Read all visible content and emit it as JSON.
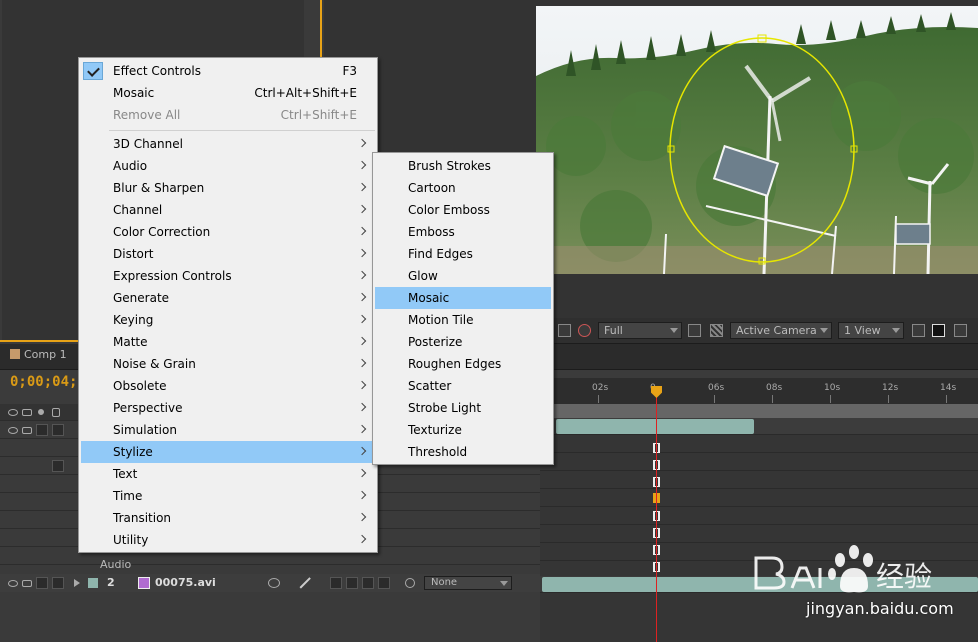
{
  "timeline": {
    "tab_label": "Comp 1",
    "timecode": "0;00;04;0",
    "ticks": [
      "02s",
      "0",
      "06s",
      "08s",
      "10s",
      "12s",
      "14s"
    ],
    "audio_label": "Audio",
    "layer2": {
      "number": "2",
      "name": "00075.avi",
      "parent": "None"
    }
  },
  "viewer": {
    "resolution": "Full",
    "camera": "Active Camera",
    "view": "1 View"
  },
  "context_menu": {
    "items": [
      {
        "label": "Effect Controls",
        "shortcut": "F3",
        "checked": true
      },
      {
        "label": "Mosaic",
        "shortcut": "Ctrl+Alt+Shift+E"
      },
      {
        "label": "Remove All",
        "shortcut": "Ctrl+Shift+E",
        "disabled": true
      }
    ],
    "categories": [
      "3D Channel",
      "Audio",
      "Blur & Sharpen",
      "Channel",
      "Color Correction",
      "Distort",
      "Expression Controls",
      "Generate",
      "Keying",
      "Matte",
      "Noise & Grain",
      "Obsolete",
      "Perspective",
      "Simulation",
      "Stylize",
      "Text",
      "Time",
      "Transition",
      "Utility"
    ],
    "highlighted_category": "Stylize"
  },
  "submenu": {
    "items": [
      "Brush Strokes",
      "Cartoon",
      "Color Emboss",
      "Emboss",
      "Find Edges",
      "Glow",
      "Mosaic",
      "Motion Tile",
      "Posterize",
      "Roughen Edges",
      "Scatter",
      "Strobe Light",
      "Texturize",
      "Threshold"
    ],
    "highlighted": "Mosaic"
  },
  "watermark": {
    "text": "jingyan.baidu.com"
  },
  "colors": {
    "highlight": "#91c9f7",
    "accent": "#e8a317",
    "track": "#8fb5ad",
    "playhead": "#dd2222"
  }
}
